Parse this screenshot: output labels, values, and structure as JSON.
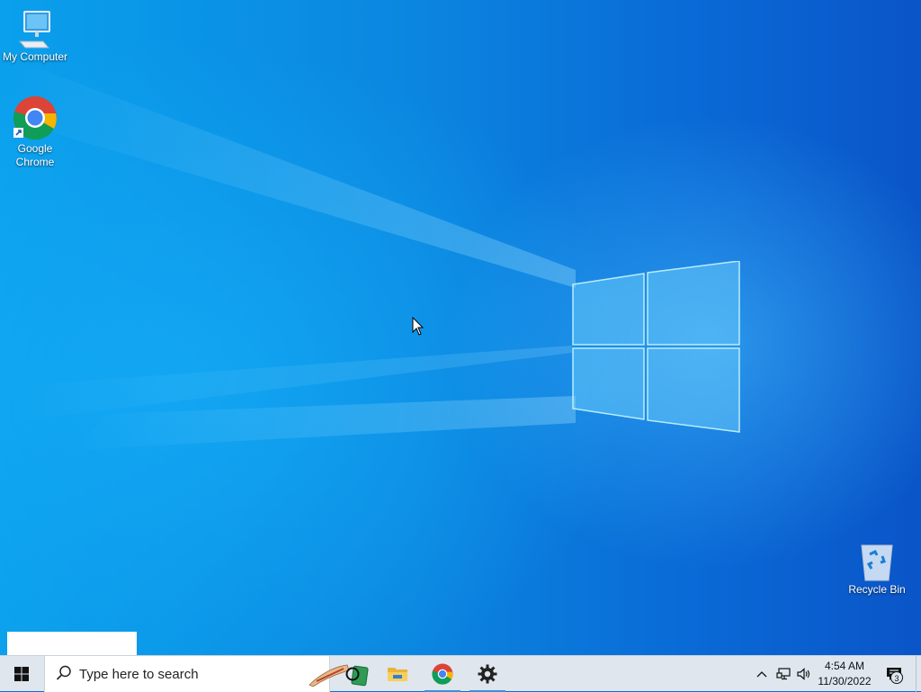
{
  "desktop": {
    "icons": [
      {
        "label": "My Computer",
        "icon": "computer-icon"
      },
      {
        "label": "Google Chrome",
        "icon": "chrome-icon"
      },
      {
        "label": "Recycle Bin",
        "icon": "recycle-bin-icon"
      }
    ]
  },
  "taskbar": {
    "search_placeholder": "Type here to search",
    "pinned": [
      {
        "name": "task-view",
        "icon": "cortana-circle-icon"
      },
      {
        "name": "file-explorer",
        "icon": "folder-icon"
      },
      {
        "name": "google-chrome",
        "icon": "chrome-icon",
        "active": true
      },
      {
        "name": "settings",
        "icon": "gear-icon",
        "active": true
      }
    ],
    "tray": {
      "time": "4:54 AM",
      "date": "11/30/2022",
      "notification_count": "3"
    }
  },
  "colors": {
    "wallpaper_light": "#0aa0ec",
    "wallpaper_dark": "#0a55c8",
    "taskbar": "#dfe6ee",
    "active_indicator": "#3a8fd9"
  }
}
